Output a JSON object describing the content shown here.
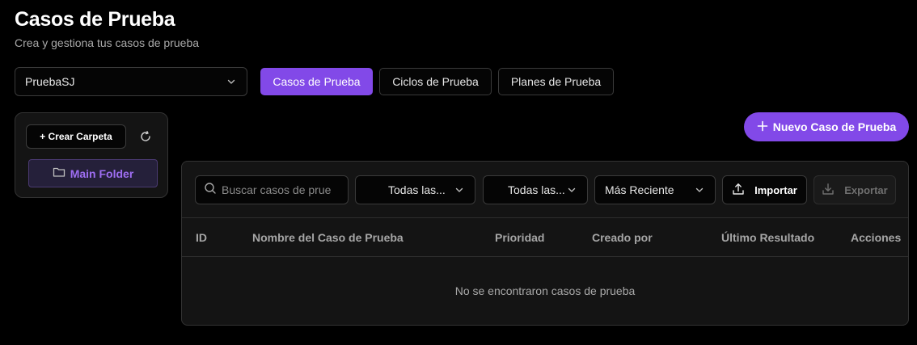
{
  "header": {
    "title": "Casos de Prueba",
    "subtitle": "Crea y gestiona tus casos de prueba"
  },
  "project_select": {
    "value": "PruebaSJ"
  },
  "tabs": [
    {
      "label": "Casos de Prueba",
      "active": true
    },
    {
      "label": "Ciclos de Prueba",
      "active": false
    },
    {
      "label": "Planes de Prueba",
      "active": false
    }
  ],
  "sidebar": {
    "create_folder_label": "+ Crear Carpeta",
    "refresh_icon": "refresh-icon",
    "folders": [
      {
        "label": "Main Folder",
        "icon": "folder-icon",
        "selected": true
      }
    ]
  },
  "new_case_button": {
    "label": "Nuevo Caso de Prueba",
    "icon": "plus-icon"
  },
  "toolbar": {
    "search_placeholder": "Buscar casos de prue",
    "filter_1": "Todas las...",
    "filter_2": "Todas las...",
    "sort": "Más Reciente",
    "import_label": "Importar",
    "export_label": "Exportar"
  },
  "table": {
    "columns": [
      "ID",
      "Nombre del Caso de Prueba",
      "Prioridad",
      "Creado por",
      "Último Resultado",
      "Acciones"
    ],
    "empty_message": "No se encontraron casos de prueba"
  },
  "colors": {
    "accent": "#8249e8",
    "background": "#000000",
    "panel": "#141414",
    "folder_text": "#9e6ef2"
  }
}
